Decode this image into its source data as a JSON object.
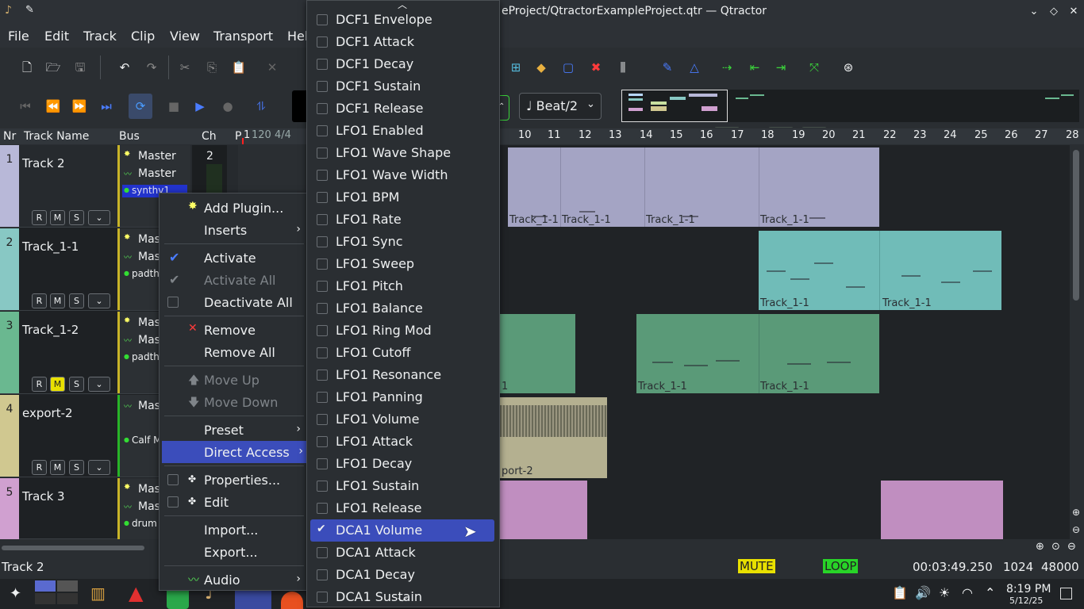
{
  "titlebar": {
    "title": "eProject/QtractorExampleProject.qtr — Qtractor",
    "minimize": "⌄",
    "maximize": "◇",
    "close": "✕"
  },
  "menubar": {
    "items": [
      "File",
      "Edit",
      "Track",
      "Clip",
      "View",
      "Transport",
      "Hel"
    ]
  },
  "toolbar": {
    "snap": "♩ Beat/2"
  },
  "header": {
    "num": "Nr",
    "track_name": "Track Name",
    "bus": "Bus",
    "ch": "Ch",
    "p": "P"
  },
  "ruler": {
    "marker": "1",
    "tempo": "120 4/4",
    "ticks": [
      "10",
      "11",
      "12",
      "13",
      "14",
      "15",
      "16",
      "17",
      "18",
      "19",
      "20",
      "21",
      "22",
      "23",
      "24",
      "25",
      "26",
      "27",
      "28"
    ]
  },
  "tracks": [
    {
      "num": "1",
      "name": "Track 2",
      "bus": [
        "Master",
        "Master"
      ],
      "plugin": "synthv1",
      "ch": "2",
      "color": "#b8b8d8",
      "buscolor": "#c8b428"
    },
    {
      "num": "2",
      "name": "Track_1-1",
      "bus": [
        "Mas",
        "Mas"
      ],
      "plugin": "padth",
      "ch": "",
      "color": "#88c8c4",
      "buscolor": "#c8b428"
    },
    {
      "num": "3",
      "name": "Track_1-2",
      "bus": [
        "Mas",
        "Mas"
      ],
      "plugin": "padth",
      "ch": "",
      "color": "#6ab890",
      "buscolor": "#c8b428"
    },
    {
      "num": "4",
      "name": "export-2",
      "bus": [
        "Mas"
      ],
      "plugin": "Calf M",
      "ch": "",
      "color": "#d0c890",
      "buscolor": "#28b428"
    },
    {
      "num": "5",
      "name": "Track 3",
      "bus": [
        "Mas",
        "Mas"
      ],
      "plugin": "drum",
      "ch": "",
      "color": "#d0a0d0",
      "buscolor": "#c8b428"
    }
  ],
  "buttons": {
    "r": "R",
    "m": "M",
    "s": "S",
    "dd": "⌄"
  },
  "clips": {
    "t1": "Track_1-1",
    "t2": "Track_1-1",
    "t3": "Track_1-1",
    "t3b": "1",
    "t4": "port-2"
  },
  "context_menu": {
    "items": [
      {
        "label": "Add Plugin...",
        "icon": "✸",
        "sub": false
      },
      {
        "label": "Inserts",
        "sub": true
      },
      {
        "label": "Activate",
        "check": "✔"
      },
      {
        "label": "Activate All",
        "check": "✔",
        "disabled": true
      },
      {
        "label": "Deactivate All"
      },
      {
        "label": "Remove",
        "icon": "✕"
      },
      {
        "label": "Remove All"
      },
      {
        "label": "Move Up",
        "icon": "🡅",
        "disabled": true
      },
      {
        "label": "Move Down",
        "icon": "🡇",
        "disabled": true
      },
      {
        "label": "Preset",
        "sub": true
      },
      {
        "label": "Direct Access",
        "sub": true,
        "highlight": true
      },
      {
        "label": "Properties..."
      },
      {
        "label": "Edit"
      },
      {
        "label": "Import..."
      },
      {
        "label": "Export..."
      },
      {
        "label": "Audio",
        "sub": true
      }
    ],
    "arrow": "›"
  },
  "direct_access": {
    "items": [
      "DCF1 Envelope",
      "DCF1 Attack",
      "DCF1 Decay",
      "DCF1 Sustain",
      "DCF1 Release",
      "LFO1 Enabled",
      "LFO1 Wave Shape",
      "LFO1 Wave Width",
      "LFO1 BPM",
      "LFO1 Rate",
      "LFO1 Sync",
      "LFO1 Sweep",
      "LFO1 Pitch",
      "LFO1 Balance",
      "LFO1 Ring Mod",
      "LFO1 Cutoff",
      "LFO1 Resonance",
      "LFO1 Panning",
      "LFO1 Volume",
      "LFO1 Attack",
      "LFO1 Decay",
      "LFO1 Sustain",
      "LFO1 Release",
      "DCA1 Volume",
      "DCA1 Attack",
      "DCA1 Decay",
      "DCA1 Sustain"
    ],
    "selected": "DCA1 Volume",
    "check": "✔",
    "scroll_up": "︿",
    "scroll_down": "﹀"
  },
  "status": {
    "track": "Track 2",
    "mute": "MUTE",
    "loop": "LOOP",
    "time": "00:03:49.250",
    "buffer": "1024",
    "rate": "48000"
  },
  "taskbar": {
    "time": "8:19 PM",
    "date": "5/12/25"
  }
}
